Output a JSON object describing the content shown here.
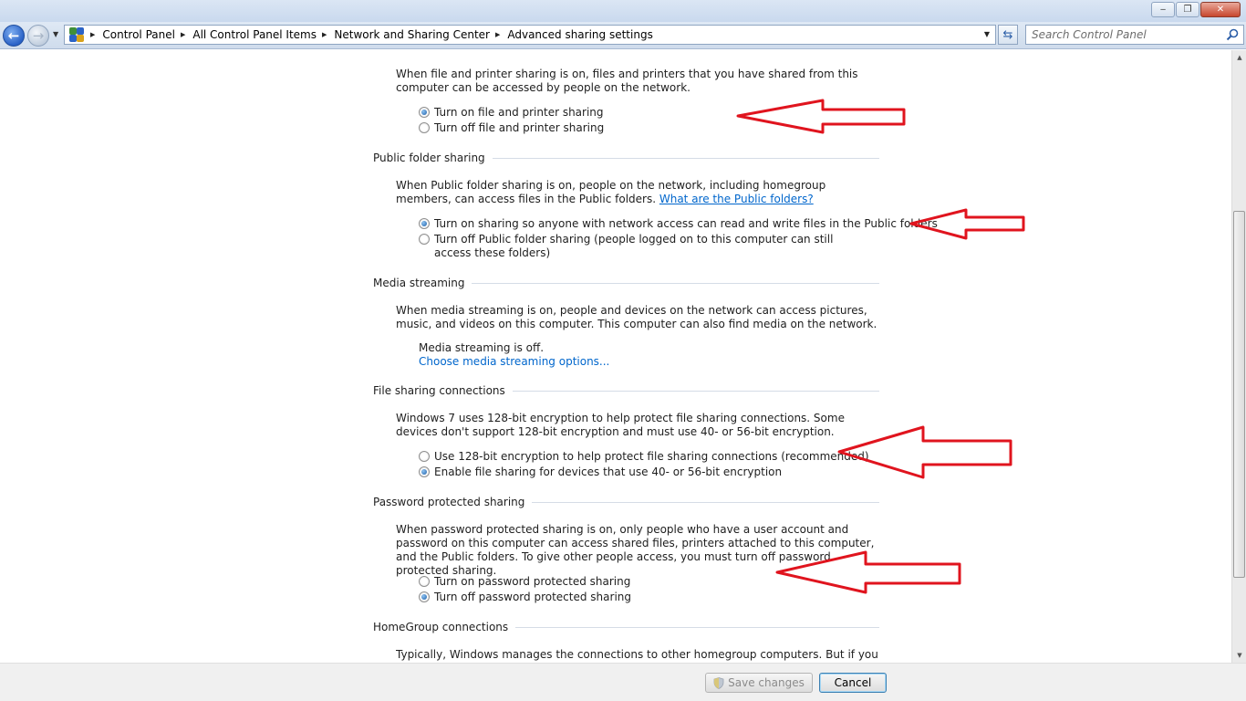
{
  "window": {
    "minimize": "‒",
    "maximize": "❐",
    "close": "✕"
  },
  "nav": {
    "back": "←",
    "forward": "→",
    "history": "▼"
  },
  "breadcrumb": [
    {
      "label": "Control Panel"
    },
    {
      "label": "All Control Panel Items"
    },
    {
      "label": "Network and Sharing Center"
    },
    {
      "label": "Advanced sharing settings"
    }
  ],
  "search": {
    "placeholder": "Search Control Panel"
  },
  "sections": {
    "file_printer": {
      "description": "When file and printer sharing is on, files and printers that you have shared from this computer can be accessed by people on the network.",
      "options": [
        {
          "label": "Turn on file and printer sharing",
          "selected": true
        },
        {
          "label": "Turn off file and printer sharing",
          "selected": false
        }
      ]
    },
    "public_folder": {
      "title": "Public folder sharing",
      "description": "When Public folder sharing is on, people on the network, including homegroup members, can access files in the Public folders.",
      "link": "What are the Public folders?",
      "options": [
        {
          "label": "Turn on sharing so anyone with network access can read and write files in the Public folders",
          "selected": true
        },
        {
          "label": "Turn off Public folder sharing (people logged on to this computer can still access these folders)",
          "selected": false
        }
      ]
    },
    "media_streaming": {
      "title": "Media streaming",
      "description": "When media streaming is on, people and devices on the network can access pictures, music, and videos on this computer. This computer can also find media on the network.",
      "status": "Media streaming is off.",
      "link": "Choose media streaming options..."
    },
    "file_sharing_connections": {
      "title": "File sharing connections",
      "description": "Windows 7 uses 128-bit encryption to help protect file sharing connections. Some devices don't support 128-bit encryption and must use 40- or 56-bit encryption.",
      "options": [
        {
          "label": "Use 128-bit encryption to help protect file sharing connections (recommended)",
          "selected": false
        },
        {
          "label": "Enable file sharing for devices that use 40- or 56-bit encryption",
          "selected": true
        }
      ]
    },
    "password_protected": {
      "title": "Password protected sharing",
      "description": "When password protected sharing is on, only people who have a user account and password on this computer can access shared files, printers attached to this computer, and the Public folders. To give other people access, you must turn off password protected sharing.",
      "options": [
        {
          "label": "Turn on password protected sharing",
          "selected": false
        },
        {
          "label": "Turn off password protected sharing",
          "selected": true
        }
      ]
    },
    "homegroup": {
      "title": "HomeGroup connections",
      "description": "Typically, Windows manages the connections to other homegroup computers. But if you have the"
    }
  },
  "buttons": {
    "save": "Save changes",
    "cancel": "Cancel"
  },
  "colors": {
    "annotation_arrow": "#e0141e",
    "link": "#0066cc"
  }
}
